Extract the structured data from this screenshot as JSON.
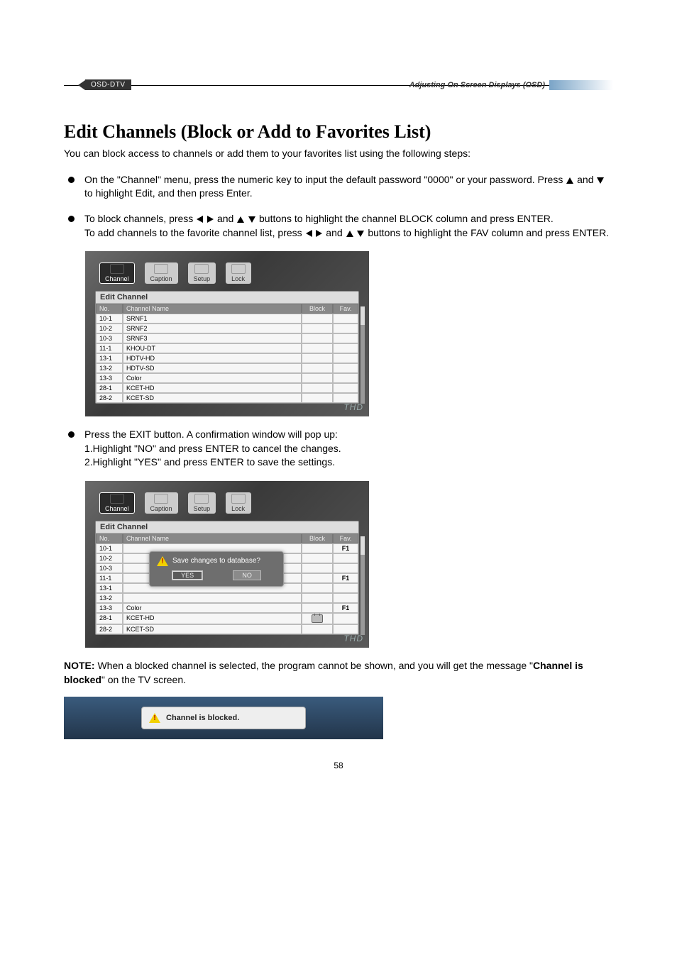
{
  "header": {
    "tag": "OSD-DTV",
    "right": "Adjusting On Screen Displays (OSD)"
  },
  "title": "Edit Channels (Block or Add to Favorites List)",
  "intro": "You can block access to channels or add them to your favorites list using the following steps:",
  "steps": {
    "s1a": "On the \"Channel\" menu, press the numeric key to input the default password \"0000\" or your password. Press ",
    "s1b": " and ",
    "s1c": " to highlight Edit, and then press Enter.",
    "s2a": "To block channels, press ",
    "s2b": " and ",
    "s2c": " buttons to highlight the channel BLOCK column and press ENTER.",
    "s2d": "To add channels to the favorite channel list, press ",
    "s2e": " and ",
    "s2f": " buttons to highlight the FAV column and press ENTER.",
    "s3": "Press the EXIT button. A confirmation window will pop up:",
    "s3_1": "1.Highlight \"NO\" and press ENTER to cancel the changes.",
    "s3_2": "2.Highlight \"YES\" and press ENTER to save the settings."
  },
  "osd": {
    "tabs": [
      "Channel",
      "Caption",
      "Setup",
      "Lock"
    ],
    "panel_title": "Edit Channel",
    "columns": {
      "no": "No.",
      "name": "Channel Name",
      "block": "Block",
      "fav": "Fav."
    },
    "rows": [
      {
        "no": "10-1",
        "name": "SRNF1"
      },
      {
        "no": "10-2",
        "name": "SRNF2"
      },
      {
        "no": "10-3",
        "name": "SRNF3"
      },
      {
        "no": "11-1",
        "name": "KHOU-DT"
      },
      {
        "no": "13-1",
        "name": "HDTV-HD"
      },
      {
        "no": "13-2",
        "name": "HDTV-SD"
      },
      {
        "no": "13-3",
        "name": "Color"
      },
      {
        "no": "28-1",
        "name": "KCET-HD"
      },
      {
        "no": "28-2",
        "name": "KCET-SD"
      }
    ],
    "watermark": "THD"
  },
  "osd2": {
    "rows": [
      {
        "no": "10-1",
        "name": "",
        "fav": "F1"
      },
      {
        "no": "10-2",
        "name": ""
      },
      {
        "no": "10-3",
        "name": ""
      },
      {
        "no": "11-1",
        "name": "",
        "fav": "F1"
      },
      {
        "no": "13-1",
        "name": ""
      },
      {
        "no": "13-2",
        "name": ""
      },
      {
        "no": "13-3",
        "name": "Color",
        "fav": "F1"
      },
      {
        "no": "28-1",
        "name": "KCET-HD",
        "block": true
      },
      {
        "no": "28-2",
        "name": "KCET-SD"
      }
    ],
    "confirm": {
      "text": "Save changes to database?",
      "yes": "YES",
      "no": "NO"
    }
  },
  "note": {
    "label": "NOTE:",
    "text1": " When a blocked channel is selected, the program cannot be shown, and you will get the message \"",
    "bold": "Channel is blocked",
    "text2": "\" on the TV screen."
  },
  "blocked_msg": "Channel is blocked.",
  "page_number": "58"
}
